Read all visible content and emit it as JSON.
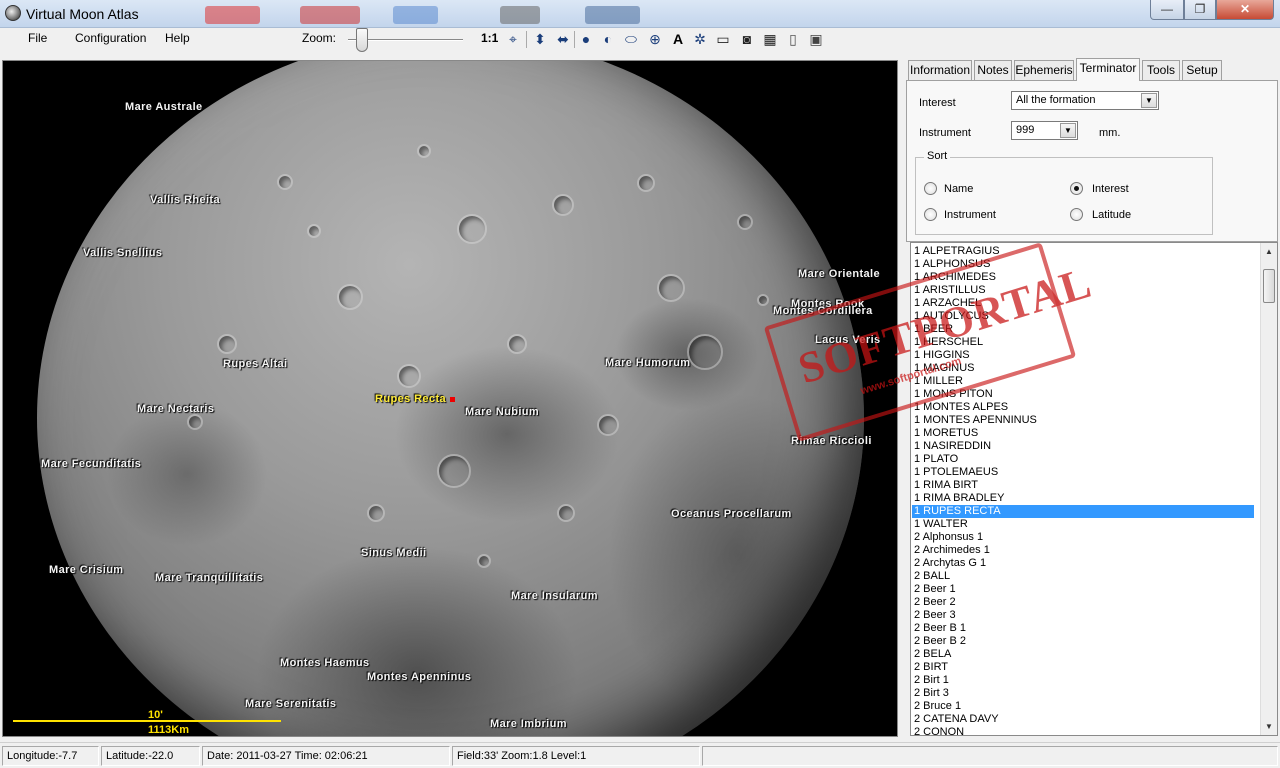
{
  "window": {
    "title": "Virtual Moon Atlas",
    "min": "—",
    "max": "❐",
    "close": "✕"
  },
  "menu": {
    "file": "File",
    "configuration": "Configuration",
    "help": "Help"
  },
  "toolbar": {
    "zoom_label": "Zoom:",
    "zoom_ratio": "1:1",
    "zoom_level": 0.1
  },
  "map": {
    "labels": [
      "Mare Australe",
      "Vallis Rheita",
      "Vallis Snellius",
      "Mare Orientale",
      "Montes Rook",
      "Montes Cordillera",
      "Lacus Veris",
      "Rupes Altai",
      "Mare Humorum",
      "Rupes Recta",
      "Mare Nectaris",
      "Mare Nubium",
      "Rimae Riccioli",
      "Mare Fecunditatis",
      "Oceanus Procellarum",
      "Sinus Medii",
      "Mare Crisium",
      "Mare Tranquillitatis",
      "Mare Insularum",
      "Montes Haemus",
      "Montes Apenninus",
      "Mare Serenitatis",
      "Mare Imbrium"
    ],
    "scale_top": "10'",
    "scale_bottom": "1113Km"
  },
  "tabs": [
    "Information",
    "Notes",
    "Ephemeris",
    "Terminator",
    "Tools",
    "Setup"
  ],
  "terminator": {
    "interest_label": "Interest",
    "interest_value": "All the formation",
    "instrument_label": "Instrument",
    "instrument_value": "999",
    "instrument_unit": "mm.",
    "sort_label": "Sort",
    "sort_options": {
      "name": "Name",
      "interest": "Interest",
      "instrument": "Instrument",
      "latitude": "Latitude"
    },
    "sort_selected": "Interest"
  },
  "list": {
    "selected_index": 20,
    "items": [
      "1 ALPETRAGIUS",
      "1 ALPHONSUS",
      "1 ARCHIMEDES",
      "1 ARISTILLUS",
      "1 ARZACHEL",
      "1 AUTOLYCUS",
      "1 BEER",
      "1 HERSCHEL",
      "1 HIGGINS",
      "1 MAGINUS",
      "1 MILLER",
      "1 MONS PITON",
      "1 MONTES ALPES",
      "1 MONTES APENNINUS",
      "1 MORETUS",
      "1 NASIREDDIN",
      "1 PLATO",
      "1 PTOLEMAEUS",
      "1 RIMA BIRT",
      "1 RIMA BRADLEY",
      "1 RUPES RECTA",
      "1 WALTER",
      "2 Alphonsus 1",
      "2 Archimedes 1",
      "2 Archytas G 1",
      "2 BALL",
      "2 Beer 1",
      "2 Beer 2",
      "2 Beer 3",
      "2 Beer B 1",
      "2 Beer B 2",
      "2 BELA",
      "2 BIRT",
      "2 Birt 1",
      "2 Birt 3",
      "2 Bruce 1",
      "2 CATENA DAVY",
      "2 CONON"
    ]
  },
  "watermark": {
    "text": "SOFTPORTAL",
    "url": "www.softportal.com"
  },
  "status": {
    "longitude": "Longitude:-7.7",
    "latitude": "Latitude:-22.0",
    "datetime": "Date: 2011-03-27  Time: 02:06:21",
    "field": "Field:33' Zoom:1.8  Level:1"
  }
}
